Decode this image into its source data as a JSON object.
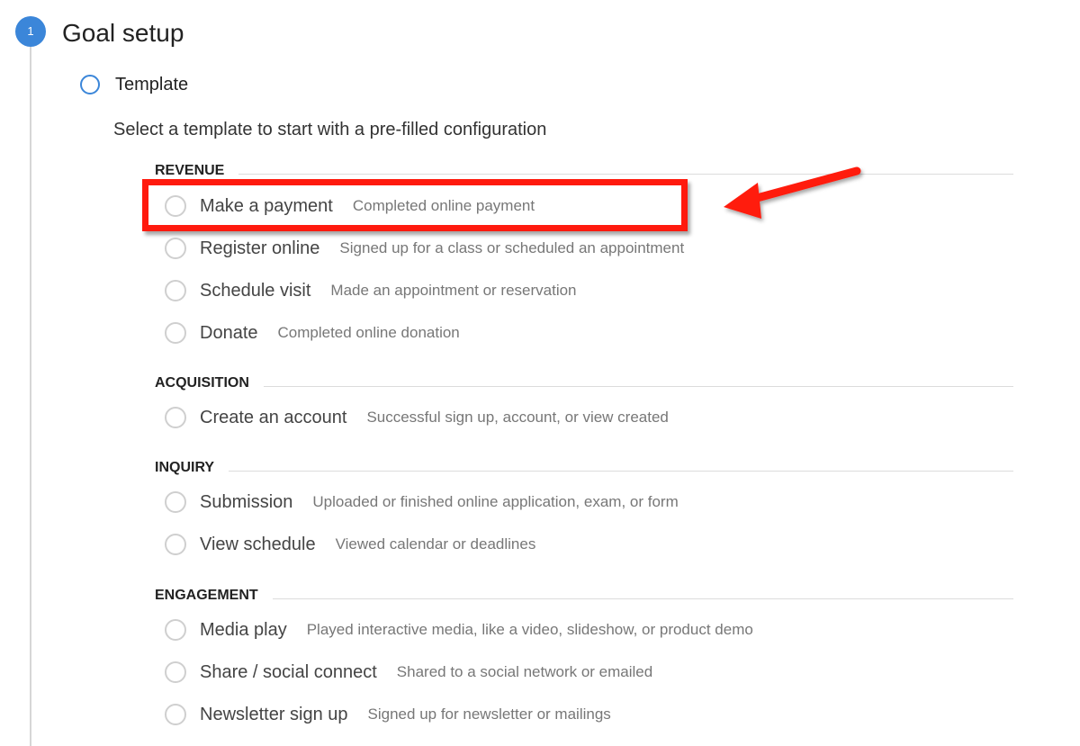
{
  "step": {
    "number": "1",
    "title": "Goal setup"
  },
  "template": {
    "label": "Template",
    "description": "Select a template to start with a pre-filled configuration"
  },
  "categories": [
    {
      "name": "REVENUE",
      "options": [
        {
          "name": "Make a payment",
          "desc": "Completed online payment",
          "highlighted": true
        },
        {
          "name": "Register online",
          "desc": "Signed up for a class or scheduled an appointment"
        },
        {
          "name": "Schedule visit",
          "desc": "Made an appointment or reservation"
        },
        {
          "name": "Donate",
          "desc": "Completed online donation"
        }
      ]
    },
    {
      "name": "ACQUISITION",
      "options": [
        {
          "name": "Create an account",
          "desc": "Successful sign up, account, or view created"
        }
      ]
    },
    {
      "name": "INQUIRY",
      "options": [
        {
          "name": "Submission",
          "desc": "Uploaded or finished online application, exam, or form"
        },
        {
          "name": "View schedule",
          "desc": "Viewed calendar or deadlines"
        }
      ]
    },
    {
      "name": "ENGAGEMENT",
      "options": [
        {
          "name": "Media play",
          "desc": "Played interactive media, like a video, slideshow, or product demo"
        },
        {
          "name": "Share / social connect",
          "desc": "Shared to a social network or emailed"
        },
        {
          "name": "Newsletter sign up",
          "desc": "Signed up for newsletter or mailings"
        }
      ]
    }
  ],
  "colors": {
    "accent": "#3b86d9",
    "annotation": "#ff1a0e"
  }
}
